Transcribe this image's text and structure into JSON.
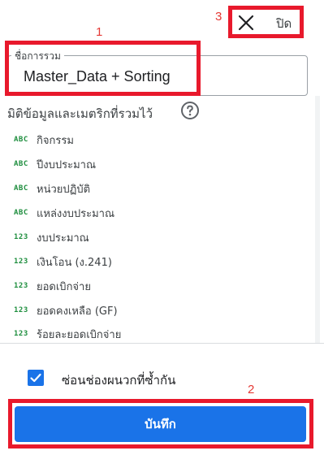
{
  "annotations": {
    "n1": "1",
    "n2": "2",
    "n3": "3"
  },
  "close": {
    "label": "ปิด",
    "icon": "close-icon"
  },
  "combined_name": {
    "label": "ชื่อการรวม",
    "value": "Master_Data + Sorting"
  },
  "section": {
    "title": "มิติข้อมูลและเมตริกที่รวมไว้",
    "help_icon": "help-circle-icon"
  },
  "fields": [
    {
      "type": "ABC",
      "name": "กิจกรรม"
    },
    {
      "type": "ABC",
      "name": "ปีงบประมาณ"
    },
    {
      "type": "ABC",
      "name": "หน่วยปฏิบัติ"
    },
    {
      "type": "ABC",
      "name": "แหล่งงบประมาณ"
    },
    {
      "type": "123",
      "name": "งบประมาณ"
    },
    {
      "type": "123",
      "name": "เงินโอน (ง.241)"
    },
    {
      "type": "123",
      "name": "ยอดเบิกจ่าย"
    },
    {
      "type": "123",
      "name": "ยอดคงเหลือ (GF)"
    },
    {
      "type": "123",
      "name": "ร้อยละยอดเบิกจ่าย"
    }
  ],
  "checkbox": {
    "label": "ซ่อนช่องผนวกที่ซ้ำกัน",
    "checked": true
  },
  "save": {
    "label": "บันทึก"
  },
  "colors": {
    "accent": "#1a73e8",
    "type_icon": "#1e8e3e",
    "annotation": "#e8192c"
  }
}
